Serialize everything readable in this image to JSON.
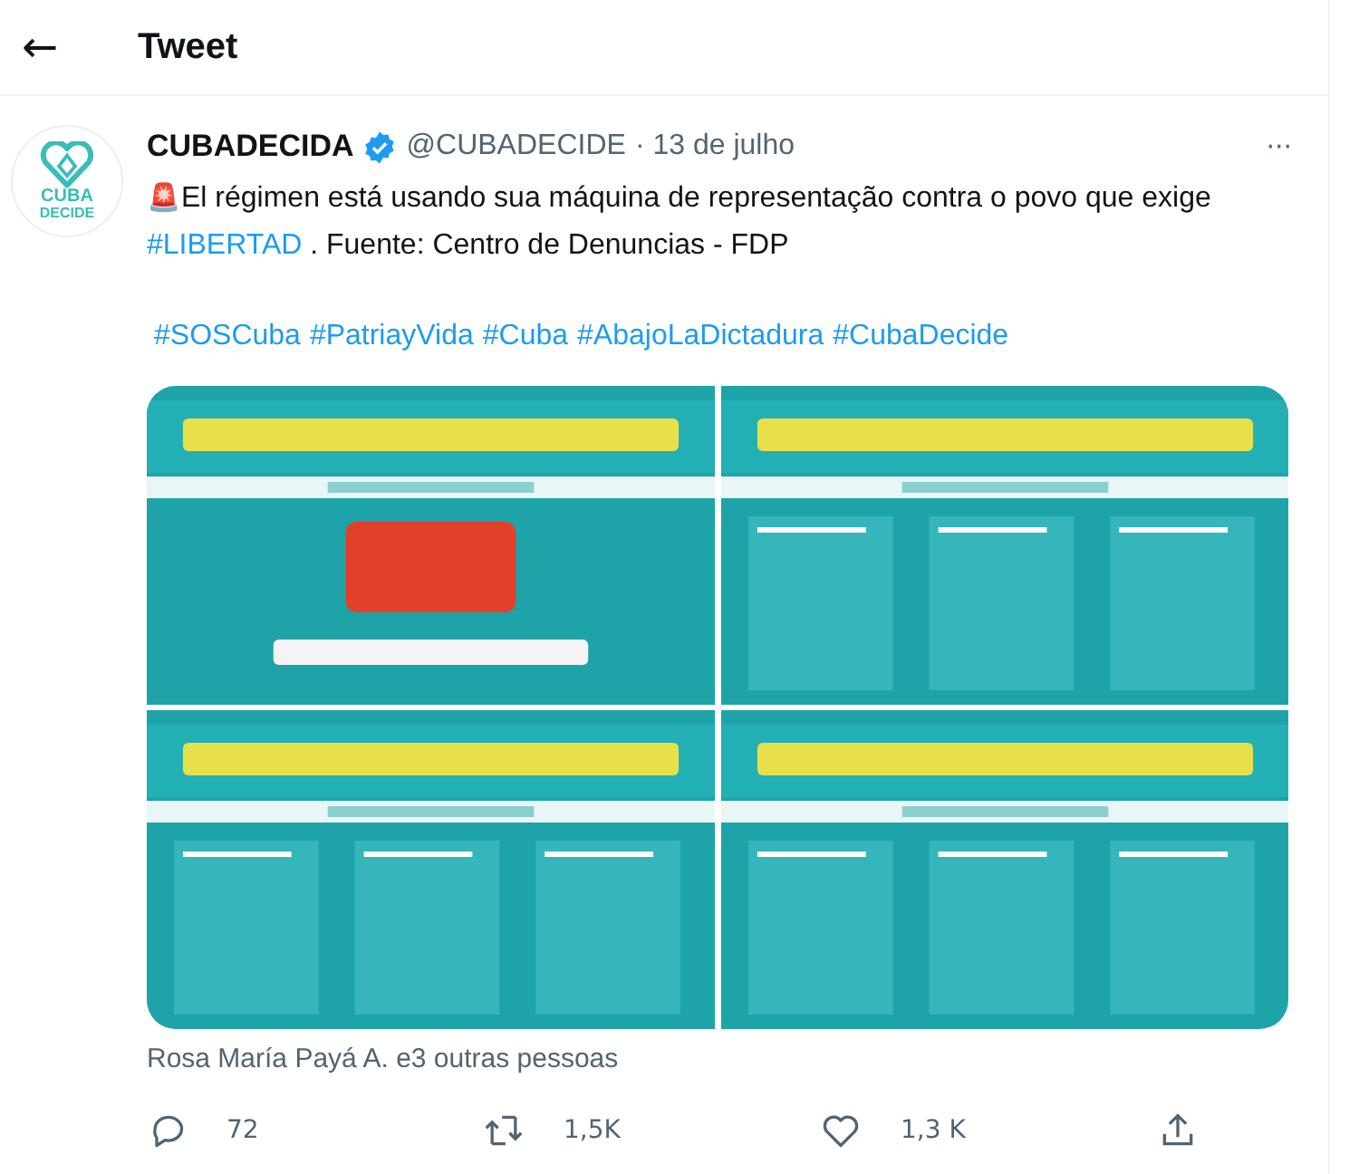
{
  "header": {
    "back": "←",
    "title": "Tweet"
  },
  "tweet": {
    "avatar": {
      "line1": "CUBA",
      "line2": "DECIDE"
    },
    "name": "CUBADECIDA",
    "verified": true,
    "handle": "@CUBADECIDE",
    "date": "· 13 de julho",
    "more": "···",
    "text_parts": [
      {
        "kind": "emoji",
        "text": "🚨"
      },
      {
        "kind": "plain",
        "text": "El régimen está usando sua máquina de representação contra o povo que exige "
      },
      {
        "kind": "hashtag",
        "text": "#LIBERTAD"
      },
      {
        "kind": "plain",
        "text": " . Fuente: Centro de Denuncias - FDP"
      }
    ],
    "hashtags": [
      "#SOSCuba",
      "#PatriayVida",
      "#Cuba",
      "#AbajoLaDictadura",
      "#CubaDecide"
    ],
    "liked_by": "Rosa María Payá A. e3 outras pessoas",
    "actions": [
      {
        "kind": "reply",
        "count": "72"
      },
      {
        "kind": "retweet",
        "count": "1,5K"
      },
      {
        "kind": "like",
        "count": "1,3 K"
      },
      {
        "kind": "share"
      }
    ]
  }
}
